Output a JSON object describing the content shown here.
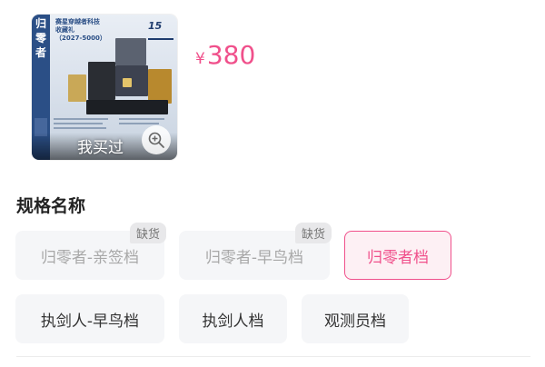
{
  "product": {
    "image_label": "我买过",
    "image_side_text": "归零者",
    "image_caption_lines": [
      "赛星穿越者科技",
      "收藏礼",
      "（2027-5000）"
    ],
    "image_badge": "15"
  },
  "price": {
    "symbol": "¥",
    "value": "380"
  },
  "spec": {
    "title": "规格名称",
    "options": [
      {
        "label": "归零者-亲签档",
        "badge": "缺货",
        "state": "disabled"
      },
      {
        "label": "归零者-早鸟档",
        "badge": "缺货",
        "state": "disabled"
      },
      {
        "label": "归零者档",
        "badge": "",
        "state": "selected"
      },
      {
        "label": "执剑人-早鸟档",
        "badge": "",
        "state": "normal"
      },
      {
        "label": "执剑人档",
        "badge": "",
        "state": "normal"
      },
      {
        "label": "观测员档",
        "badge": "",
        "state": "normal"
      }
    ]
  },
  "colors": {
    "accent": "#f0508b",
    "chip_bg": "#f5f6f8",
    "image_blue": "#2b4f86"
  }
}
